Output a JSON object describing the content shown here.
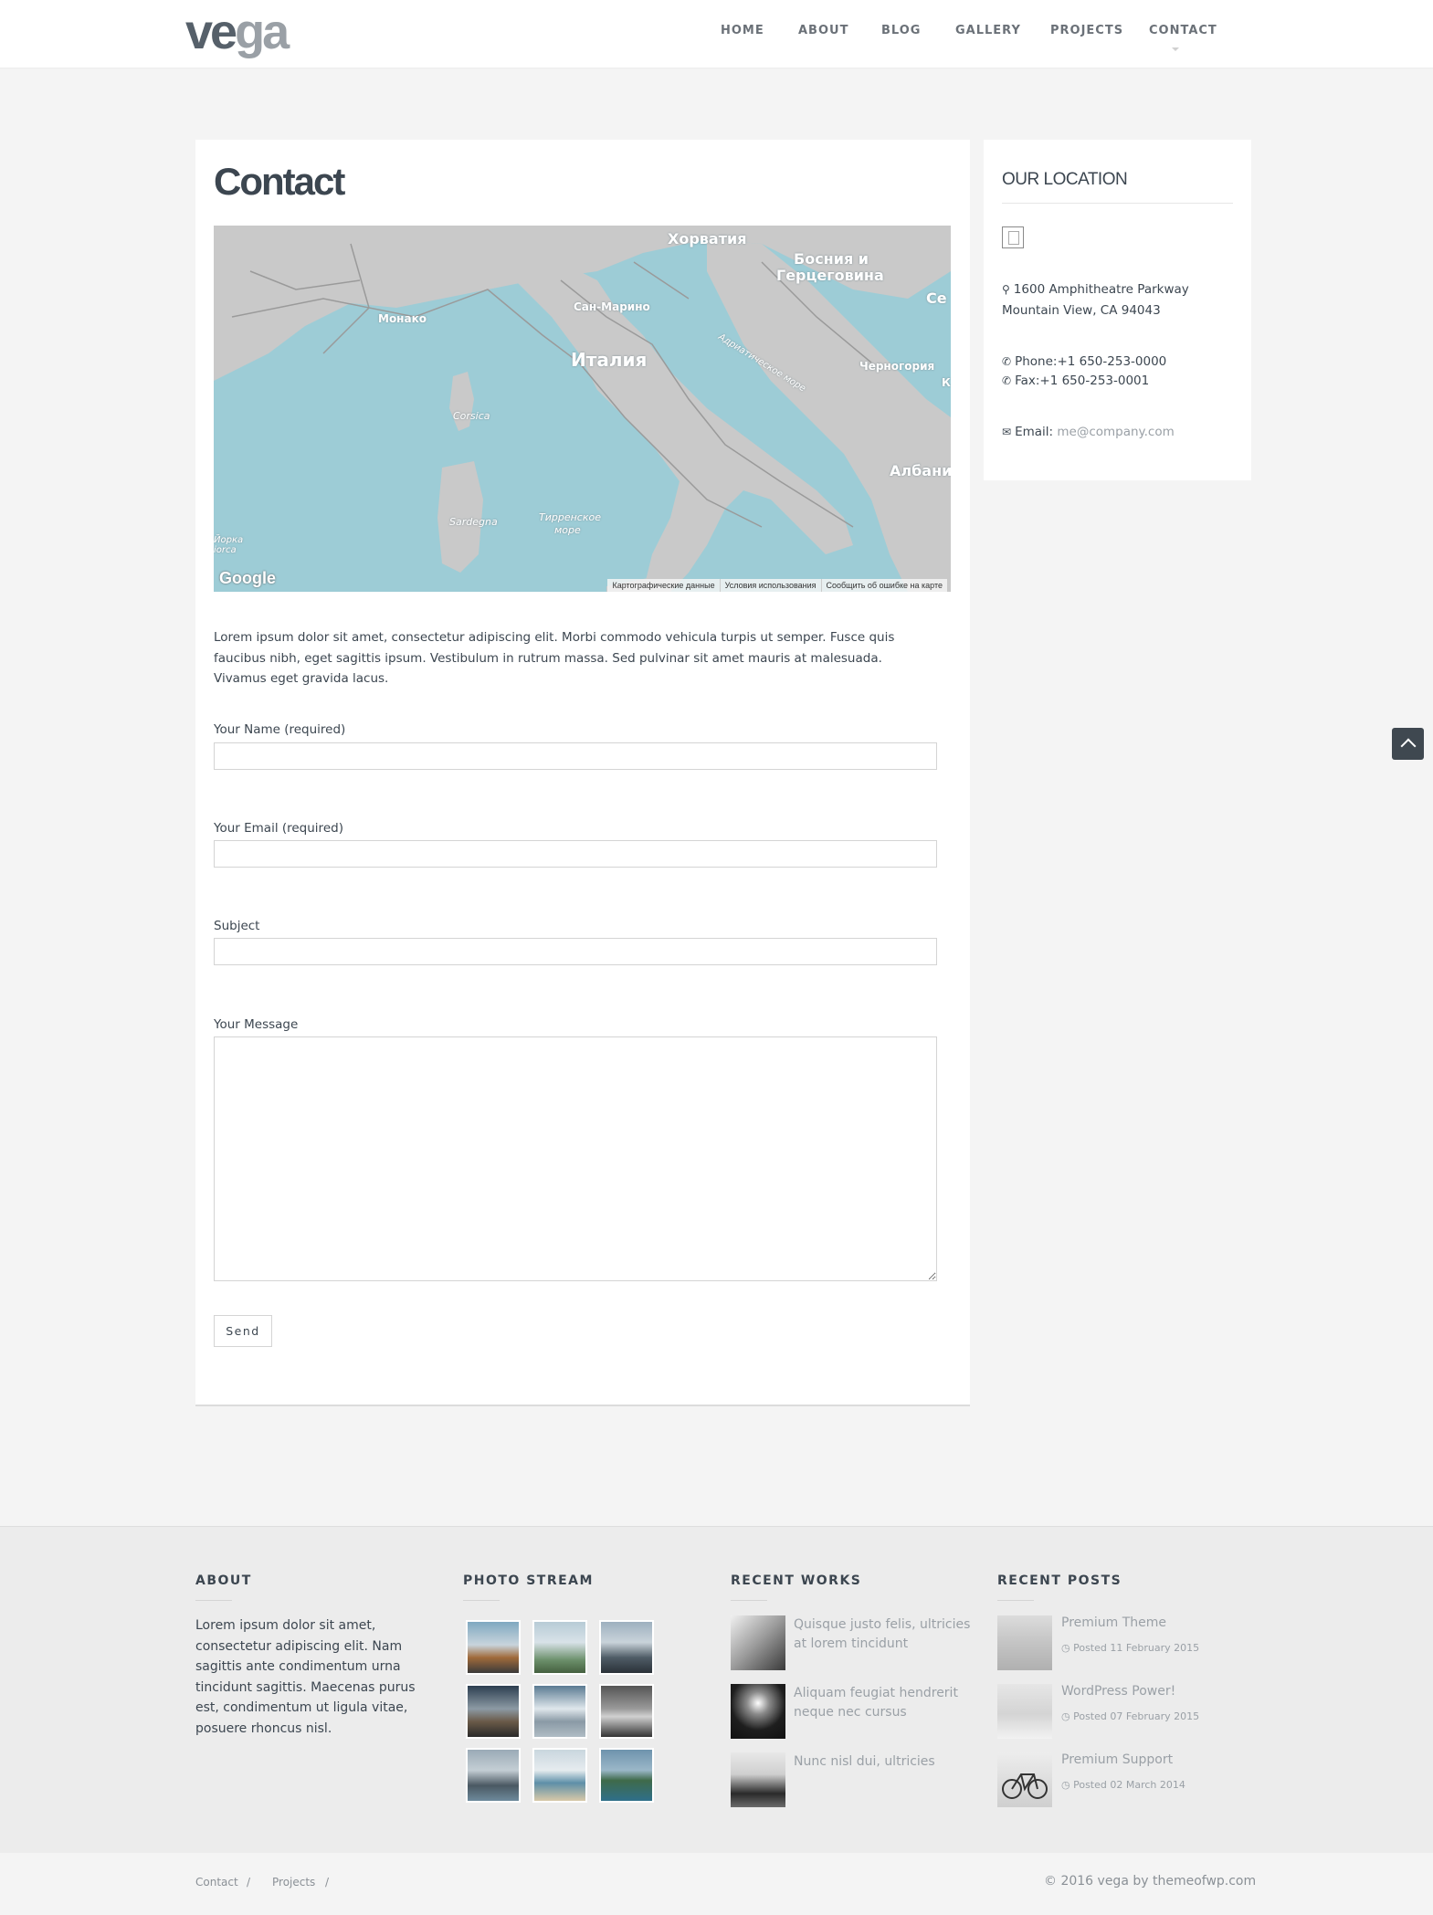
{
  "header": {
    "logo_part1": "ve",
    "logo_part2": "ga",
    "nav": [
      "HOME",
      "ABOUT",
      "BLOG",
      "GALLERY",
      "PROJECTS",
      "CONTACT"
    ]
  },
  "main": {
    "title": "Contact",
    "map": {
      "labels": [
        "Хорватия",
        "Босния и",
        "Герцеговина",
        "Се",
        "Монако",
        "Сан-Марино",
        "Италия",
        "Адриатическое море",
        "Черногория",
        "К",
        "Corsica",
        "Албани",
        "Sardegna",
        "Тирренское",
        "море",
        "Йорка",
        "iorca"
      ],
      "google": "Google",
      "footer": [
        "Картографические данные",
        "Условия использования",
        "Сообщить об ошибке на карте"
      ]
    },
    "intro": "Lorem ipsum dolor sit amet, consectetur adipiscing elit. Morbi commodo vehicula turpis ut semper. Fusce quis faucibus nibh, eget sagittis ipsum. Vestibulum in rutrum massa. Sed pulvinar sit amet mauris at malesuada. Vivamus eget gravida lacus.",
    "form": {
      "name_label": "Your Name (required)",
      "email_label": "Your Email (required)",
      "subject_label": "Subject",
      "message_label": "Your Message",
      "name_value": "",
      "email_value": "",
      "subject_value": "",
      "message_value": "",
      "send_label": "Send"
    }
  },
  "sidebar": {
    "title": "OUR LOCATION",
    "address_line1": "1600 Amphitheatre Parkway",
    "address_line2": "Mountain View, CA 94043",
    "phone_label": "Phone:",
    "phone": "+1 650-253-0000",
    "fax_label": "Fax:",
    "fax": "+1 650-253-0001",
    "email_label": "Email:",
    "email": "me@company.com"
  },
  "footer": {
    "about_title": "ABOUT",
    "about_text": "Lorem ipsum dolor sit amet, consectetur adipiscing elit. Nam sagittis ante condimentum urna tincidunt sagittis. Maecenas purus est, condimentum ut ligula vitae, posuere rhoncus nisl.",
    "photo_title": "PHOTO STREAM",
    "works_title": "RECENT WORKS",
    "works": [
      {
        "line1": "Quisque justo felis, ultricies",
        "line2": "at lorem tincidunt"
      },
      {
        "line1": "Aliquam feugiat hendrerit",
        "line2": "neque nec cursus"
      },
      {
        "line1": "Nunc nisl dui, ultricies",
        "line2": ""
      }
    ],
    "posts_title": "RECENT POSTS",
    "posts": [
      {
        "title": "Premium Theme",
        "date": "Posted 11 February 2015"
      },
      {
        "title": "WordPress Power!",
        "date": "Posted 07 February 2015"
      },
      {
        "title": "Premium Support",
        "date": "Posted 02 March 2014"
      }
    ]
  },
  "bottom": {
    "links": [
      "Contact",
      "Projects"
    ],
    "separator": "/",
    "copyright": "© 2016 vega by themeofwp.com"
  },
  "icons": {
    "map_marker": "map-marker-icon",
    "phone": "phone-icon",
    "envelope": "envelope-icon",
    "clock": "clock-icon",
    "back_to_top": "chevron-up-icon"
  }
}
